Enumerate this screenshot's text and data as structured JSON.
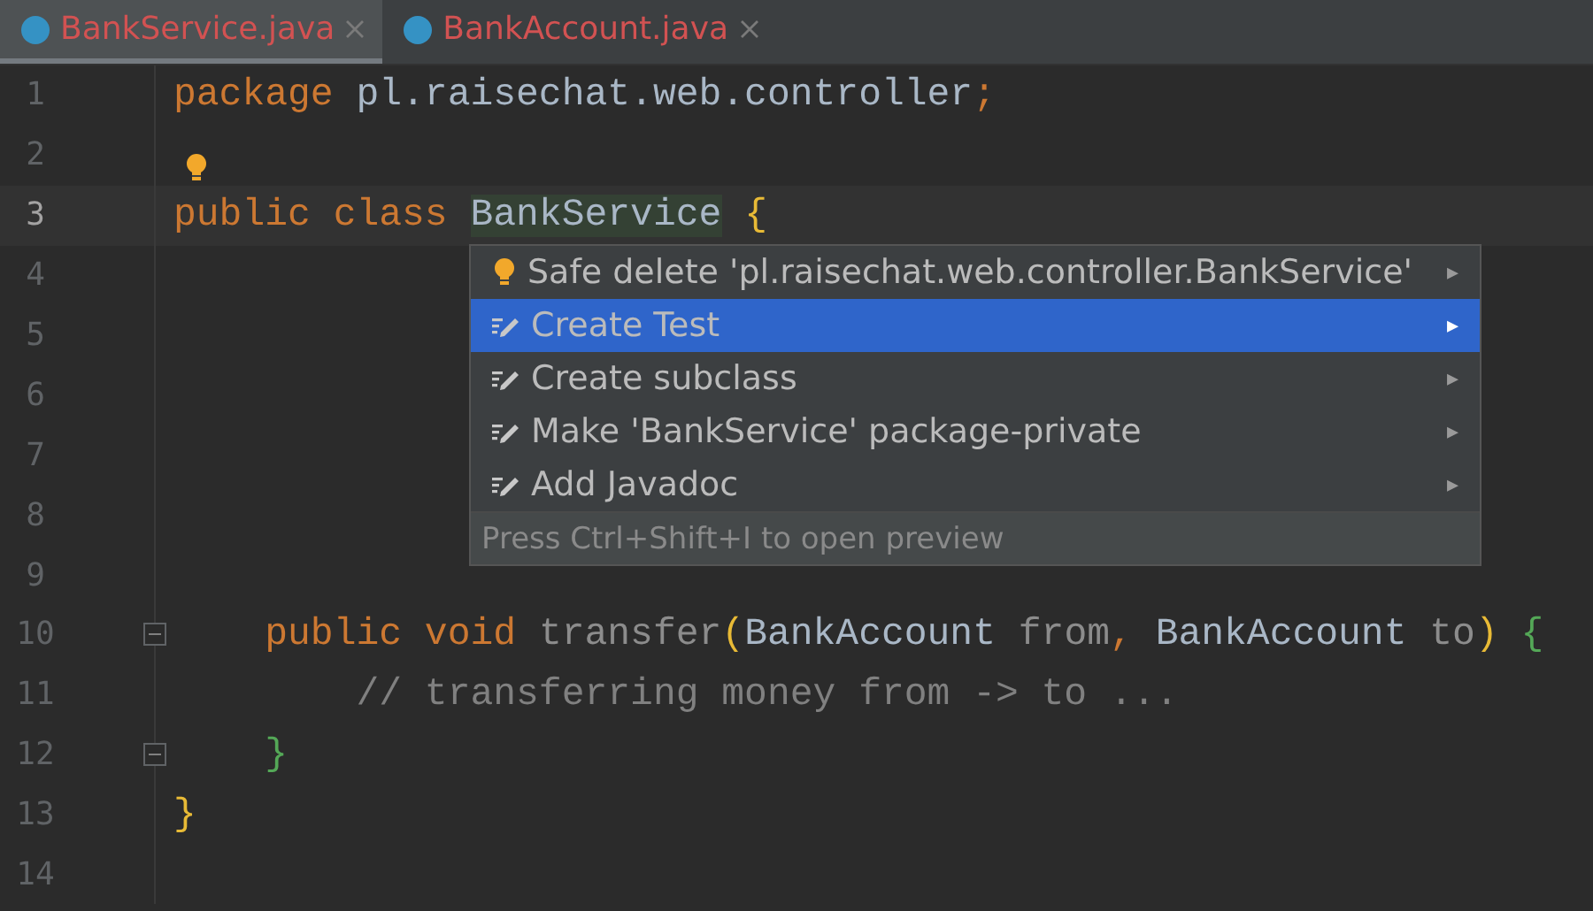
{
  "tabs": [
    {
      "label": "BankService.java",
      "selected": true
    },
    {
      "label": "BankAccount.java",
      "selected": false
    }
  ],
  "editor": {
    "lines": [
      {
        "number": "1",
        "current": false,
        "tokens": [
          {
            "text": "package ",
            "kind": "keyword"
          },
          {
            "text": "pl.raisechat.web.controller",
            "kind": "ident"
          },
          {
            "text": ";",
            "kind": "keyword"
          }
        ]
      },
      {
        "number": "2",
        "current": false,
        "bulb": true
      },
      {
        "number": "3",
        "current": true,
        "tokens": [
          {
            "text": "public class ",
            "kind": "keyword"
          },
          {
            "text": "BankService",
            "kind": "highlighted"
          },
          {
            "text": " {",
            "kind": "brace-outer"
          }
        ]
      },
      {
        "number": "4",
        "current": false
      },
      {
        "number": "5",
        "current": false
      },
      {
        "number": "6",
        "current": false
      },
      {
        "number": "7",
        "current": false
      },
      {
        "number": "8",
        "current": false
      },
      {
        "number": "9",
        "current": false
      },
      {
        "number": "10",
        "current": false,
        "fold": true,
        "tokens": [
          {
            "text": "    public void ",
            "kind": "keyword"
          },
          {
            "text": "transfer",
            "kind": "unused"
          },
          {
            "text": "(",
            "kind": "brace-outer"
          },
          {
            "text": "BankAccount ",
            "kind": "ident"
          },
          {
            "text": "from",
            "kind": "unused"
          },
          {
            "text": ", ",
            "kind": "keyword"
          },
          {
            "text": "BankAccount ",
            "kind": "ident"
          },
          {
            "text": "to",
            "kind": "unused"
          },
          {
            "text": ") ",
            "kind": "brace-outer"
          },
          {
            "text": "{",
            "kind": "brace-inner"
          }
        ]
      },
      {
        "number": "11",
        "current": false,
        "tokens": [
          {
            "text": "        // transferring money from -> to ...",
            "kind": "comment"
          }
        ]
      },
      {
        "number": "12",
        "current": false,
        "fold": true,
        "tokens": [
          {
            "text": "    }",
            "kind": "brace-inner"
          }
        ]
      },
      {
        "number": "13",
        "current": false,
        "tokens": [
          {
            "text": "}",
            "kind": "brace-outer"
          }
        ]
      },
      {
        "number": "14",
        "current": false
      }
    ]
  },
  "popup": {
    "items": [
      {
        "label": "Safe delete 'pl.raisechat.web.controller.BankService'",
        "kind": "bulb",
        "selected": false,
        "arrow": "▸"
      },
      {
        "label": "Create Test",
        "kind": "edit",
        "selected": true,
        "arrow": "▸"
      },
      {
        "label": "Create subclass",
        "kind": "edit",
        "selected": false,
        "arrow": "▸"
      },
      {
        "label": "Make 'BankService' package-private",
        "kind": "edit",
        "selected": false,
        "arrow": "▸"
      },
      {
        "label": "Add Javadoc",
        "kind": "edit",
        "selected": false,
        "arrow": "▸"
      }
    ],
    "hint": "Press Ctrl+Shift+I to open preview"
  }
}
